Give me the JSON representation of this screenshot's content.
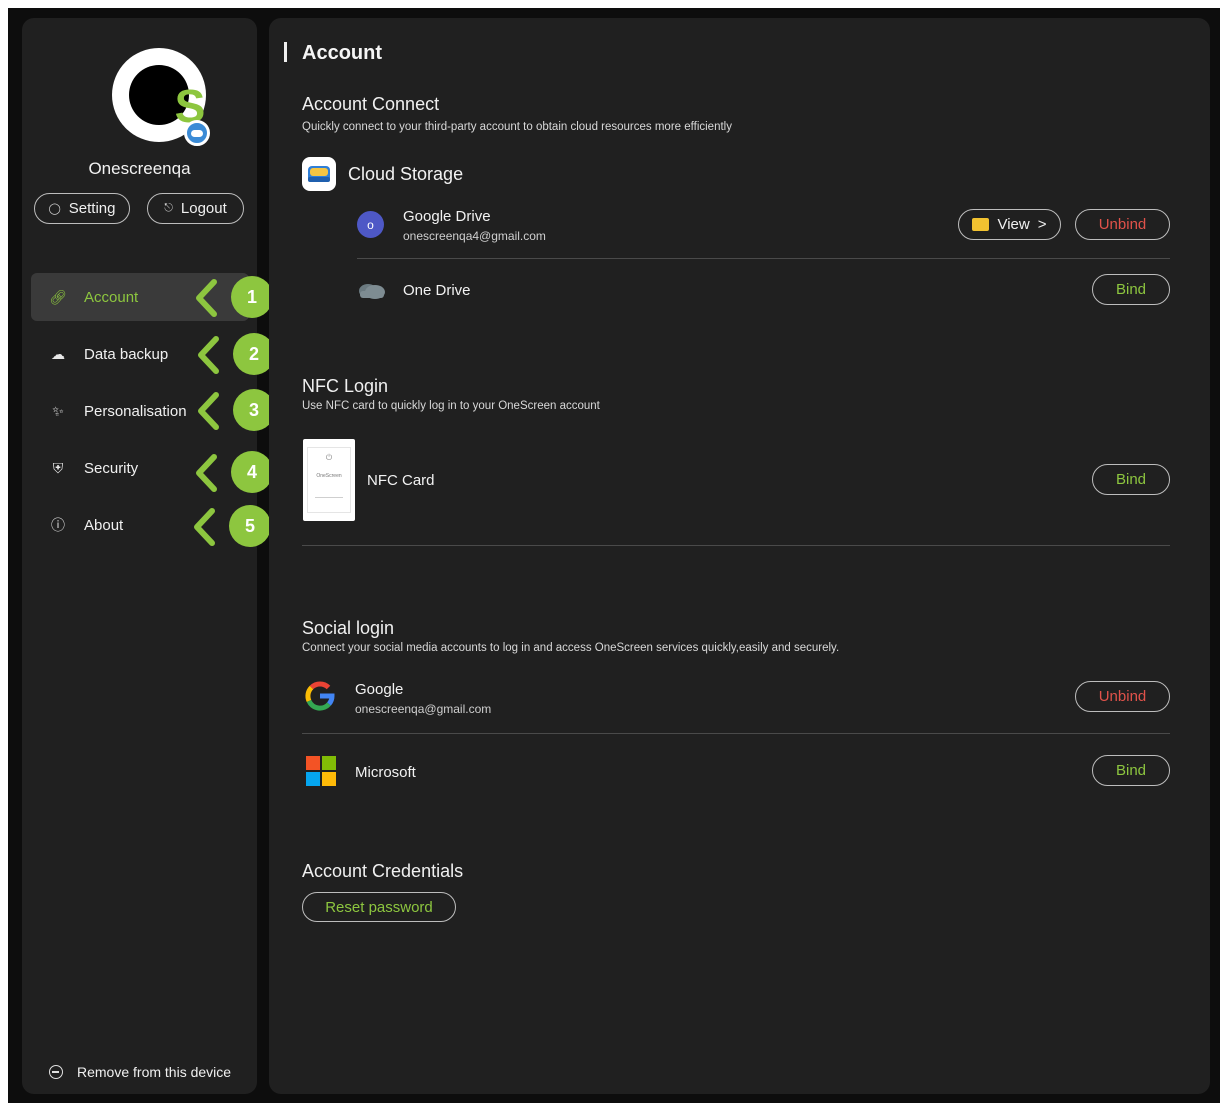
{
  "sidebar": {
    "username": "Onescreenqa",
    "setting_label": "Setting",
    "logout_label": "Logout",
    "items": [
      {
        "label": "Account",
        "icon": "link-icon",
        "active": true
      },
      {
        "label": "Data backup",
        "icon": "cloud-upload-icon",
        "active": false
      },
      {
        "label": "Personalisation",
        "icon": "sparkle-icon",
        "active": false
      },
      {
        "label": "Security",
        "icon": "shield-icon",
        "active": false
      },
      {
        "label": "About",
        "icon": "info-icon",
        "active": false
      }
    ],
    "callouts": [
      "1",
      "2",
      "3",
      "4",
      "5"
    ],
    "remove_label": "Remove from this device"
  },
  "main": {
    "title": "Account",
    "account_connect": {
      "title": "Account Connect",
      "description": "Quickly connect to your third-party account to obtain cloud resources more efficiently",
      "cloud_storage_label": "Cloud Storage",
      "google_drive": {
        "name": "Google Drive",
        "email": "onescreenqa4@gmail.com",
        "avatar_letter": "o",
        "view_label": "View",
        "view_arrow": ">",
        "action_label": "Unbind"
      },
      "one_drive": {
        "name": "One Drive",
        "action_label": "Bind"
      }
    },
    "nfc_login": {
      "title": "NFC Login",
      "description": "Use NFC card to quickly log in to your OneScreen account",
      "card_label": "NFC Card",
      "card_thumb_brand": "OneScreen",
      "action_label": "Bind"
    },
    "social_login": {
      "title": "Social login",
      "description": "Connect your social media accounts to log in and access OneScreen services quickly,easily and securely.",
      "google": {
        "name": "Google",
        "email": "onescreenqa@gmail.com",
        "action_label": "Unbind"
      },
      "microsoft": {
        "name": "Microsoft",
        "action_label": "Bind"
      }
    },
    "credentials": {
      "title": "Account Credentials",
      "reset_label": "Reset password"
    }
  },
  "colors": {
    "accent": "#8dc63f",
    "danger": "#e0524a",
    "panel": "#202020",
    "background": "#0d0d0d"
  }
}
